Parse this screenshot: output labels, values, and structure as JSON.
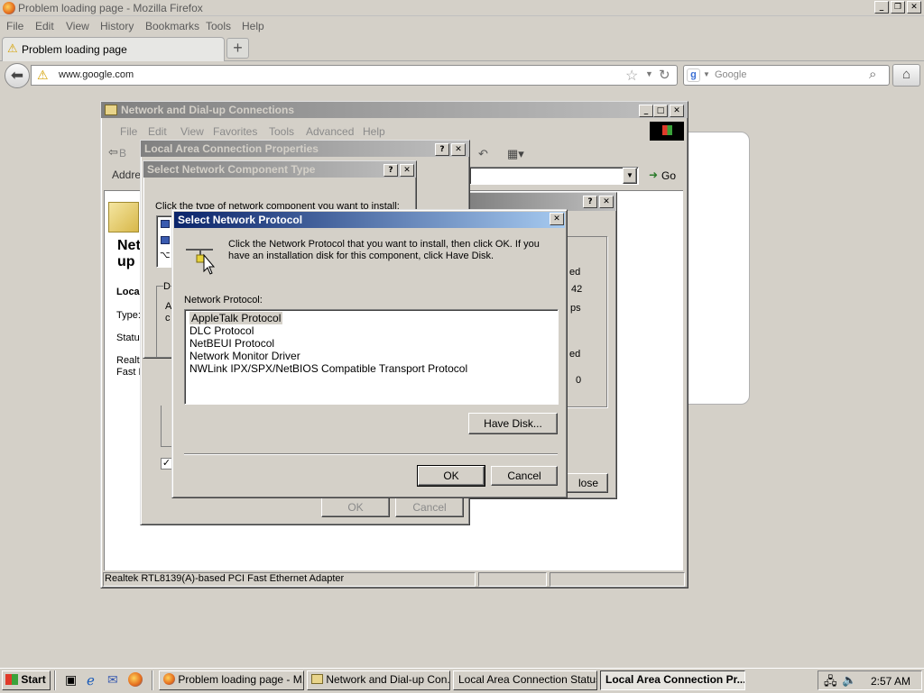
{
  "firefox": {
    "title": "Problem loading page - Mozilla Firefox",
    "menu": [
      "File",
      "Edit",
      "View",
      "History",
      "Bookmarks",
      "Tools",
      "Help"
    ],
    "tab_title": "Problem loading page",
    "new_tab": "+",
    "url": "www.google.com",
    "search_engine": "Google",
    "search_placeholder": "Google"
  },
  "explorer": {
    "title": "Network and Dial-up Connections",
    "menu": [
      "File",
      "Edit",
      "View",
      "Favorites",
      "Tools",
      "Advanced",
      "Help"
    ],
    "back_label": "B",
    "address_label": "Addre",
    "go_label": "Go",
    "heading_line1": "Net",
    "heading_line2": "up",
    "side_local": "Loca",
    "side_type": "Type:",
    "side_status": "Statu",
    "side_adapter1": "Realt",
    "side_adapter2": "Fast E",
    "status_bar": "Realtek RTL8139(A)-based PCI Fast Ethernet Adapter"
  },
  "lac_properties": {
    "title": "Local Area Connection Properties",
    "ok": "OK",
    "cancel": "Cancel",
    "partial_d": "D",
    "partial_a": "A",
    "partial_c": "c"
  },
  "component_type": {
    "title": "Select Network Component Type",
    "prompt": "Click the type of network component you want to install:"
  },
  "status_dialog": {
    "val1": "ed",
    "val2": "42",
    "val3": "ps",
    "val4": "ed",
    "val5": "0",
    "close": "lose"
  },
  "protocol_dialog": {
    "title": "Select Network Protocol",
    "description": "Click the Network Protocol that you want to install, then click OK. If you have an installation disk for this component, click Have Disk.",
    "list_label": "Network Protocol:",
    "protocols": [
      "AppleTalk Protocol",
      "DLC Protocol",
      "NetBEUI Protocol",
      "Network Monitor Driver",
      "NWLink IPX/SPX/NetBIOS Compatible Transport Protocol"
    ],
    "have_disk": "Have Disk...",
    "ok": "OK",
    "cancel": "Cancel"
  },
  "taskbar": {
    "start": "Start",
    "items": [
      "Problem loading page - M...",
      "Network and Dial-up Con...",
      "Local Area Connection Status",
      "Local Area Connection Pr..."
    ],
    "clock": "2:57 AM"
  }
}
